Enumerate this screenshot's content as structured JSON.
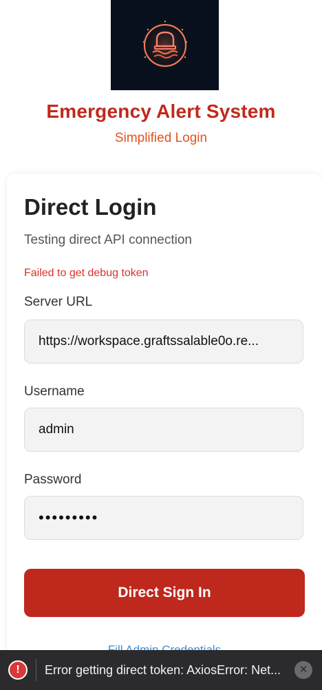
{
  "header": {
    "logo_icon": "alarm-beacon-icon",
    "title": "Emergency Alert System",
    "subtitle": "Simplified Login"
  },
  "card": {
    "title": "Direct Login",
    "subtitle": "Testing direct API connection",
    "error": "Failed to get debug token",
    "fields": {
      "server_url": {
        "label": "Server URL",
        "value": "https://workspace.graftssalable0o.re..."
      },
      "username": {
        "label": "Username",
        "value": "admin"
      },
      "password": {
        "label": "Password",
        "value": "•••••••••"
      }
    },
    "sign_in_label": "Direct Sign In",
    "fill_link": "Fill Admin Credentials"
  },
  "toast": {
    "icon": "error-circle-icon",
    "message": "Error getting direct token: AxiosError: Net...",
    "close_icon": "close-icon"
  },
  "colors": {
    "brand_red": "#c0291d",
    "accent_orange": "#e4521c",
    "button_red": "#be281d",
    "link_blue": "#3b8ed6",
    "error_red": "#d9322b",
    "toast_bg": "#2b2b2d"
  }
}
